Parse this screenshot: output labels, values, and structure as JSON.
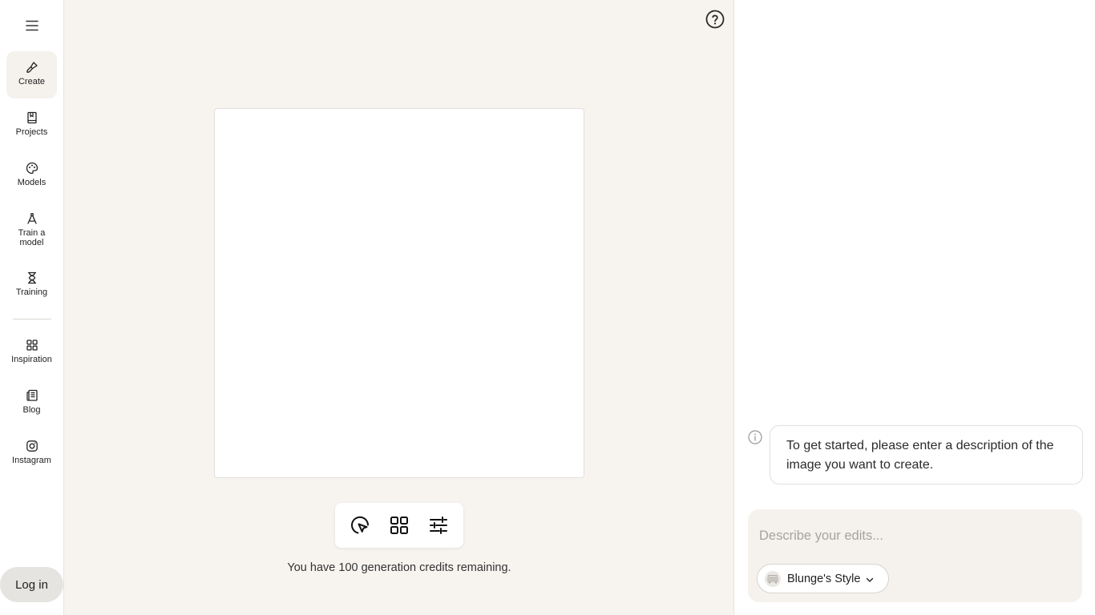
{
  "sidebar": {
    "menu_icon": "hamburger-menu-icon",
    "items": [
      {
        "label": "Create",
        "icon": "paintbrush-icon",
        "active": true
      },
      {
        "label": "Projects",
        "icon": "book-icon"
      },
      {
        "label": "Models",
        "icon": "palette-icon"
      },
      {
        "label": "Train a model",
        "icon": "compass-drafting-icon"
      },
      {
        "label": "Training",
        "icon": "hourglass-icon"
      },
      {
        "label": "Inspiration",
        "icon": "grid-icon"
      },
      {
        "label": "Blog",
        "icon": "newspaper-icon"
      },
      {
        "label": "Instagram",
        "icon": "instagram-icon"
      }
    ],
    "login_label": "Log in"
  },
  "main": {
    "help_icon": "question-circle-icon",
    "toolbar": [
      {
        "icon": "select-cursor-icon"
      },
      {
        "icon": "grid-icon"
      },
      {
        "icon": "sliders-icon"
      }
    ],
    "credits_text": "You have 100 generation credits remaining."
  },
  "chat": {
    "info_icon": "info-icon",
    "message": "To get started, please enter a description of the image you want to create.",
    "input_placeholder": "Describe your edits...",
    "input_value": "",
    "style_label": "Blunge's Style"
  },
  "colors": {
    "canvas_bg": "#f7f4f0",
    "active_nav_bg": "#f5f2ee",
    "login_bg": "#e6e4e1",
    "text": "#1f1f1f"
  }
}
